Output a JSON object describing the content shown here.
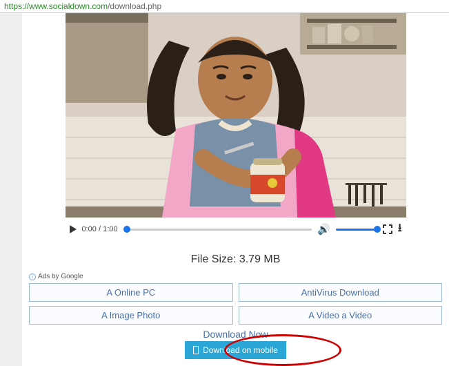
{
  "url": {
    "protocol": "https://",
    "host": "www.socialdown.com",
    "path": "/download.php"
  },
  "video": {
    "current_time": "0:00",
    "duration": "1:00"
  },
  "file_size_label": "File Size: 3.79 MB",
  "ads": {
    "label": "Ads by Google",
    "buttons": [
      "A Online PC",
      "AntiVirus Download",
      "A Image Photo",
      "A Video a Video"
    ]
  },
  "download_now_label": "Download Now",
  "mobile_button_label": "Download on mobile"
}
